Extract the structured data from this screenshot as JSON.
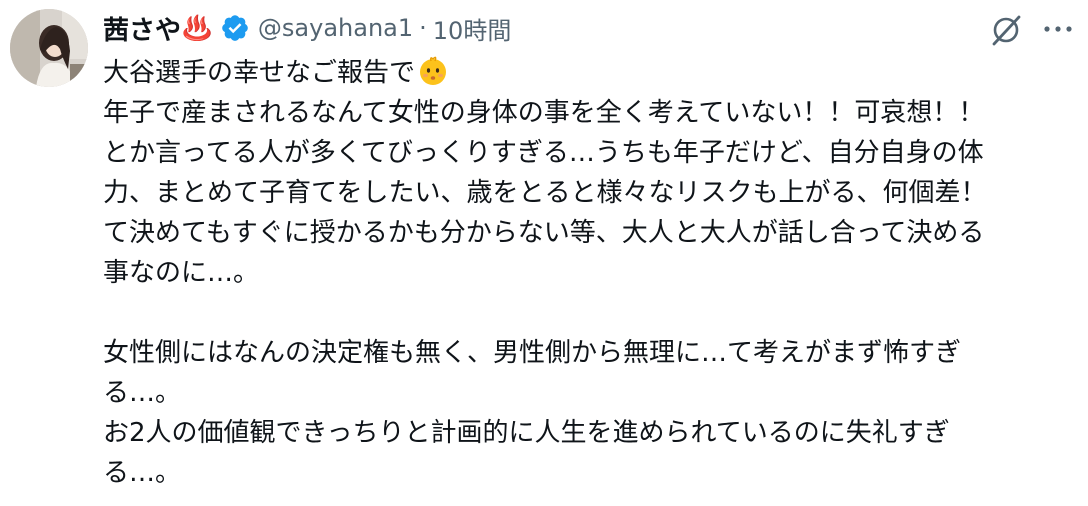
{
  "author": {
    "display_name": "茜さや",
    "name_emoji": "♨️",
    "verified_icon": "verified-badge-icon",
    "handle": "@sayahana1",
    "separator": "·",
    "time": "10時間"
  },
  "actions": {
    "grok_icon": "grok-icon",
    "more_icon": "more-options-icon"
  },
  "tweet": {
    "line1": "大谷選手の幸せなご報告で",
    "line1_emoji": "baby-face-emoji",
    "line2": "年子で産まされるなんて女性の身体の事を全く考えていない！！可哀想！！",
    "line3": "とか言ってる人が多くてびっくりすぎる…うちも年子だけど、自分自身の体",
    "line4": "力、まとめて子育てをしたい、歳をとると様々なリスクも上がる、何個差！",
    "line5": "て決めてもすぐに授かるかも分からない等、大人と大人が話し合って決める",
    "line6": "事なのに…。",
    "line7": "女性側にはなんの決定権も無く、男性側から無理に…て考えがまず怖すぎ",
    "line8": "る…。",
    "line9": "お2人の価値観できっちりと計画的に人生を進められているのに失礼すぎ",
    "line10": "る…。"
  },
  "colors": {
    "text": "#0f1419",
    "secondary": "#536471",
    "verified": "#1d9bf0",
    "background": "#ffffff"
  }
}
